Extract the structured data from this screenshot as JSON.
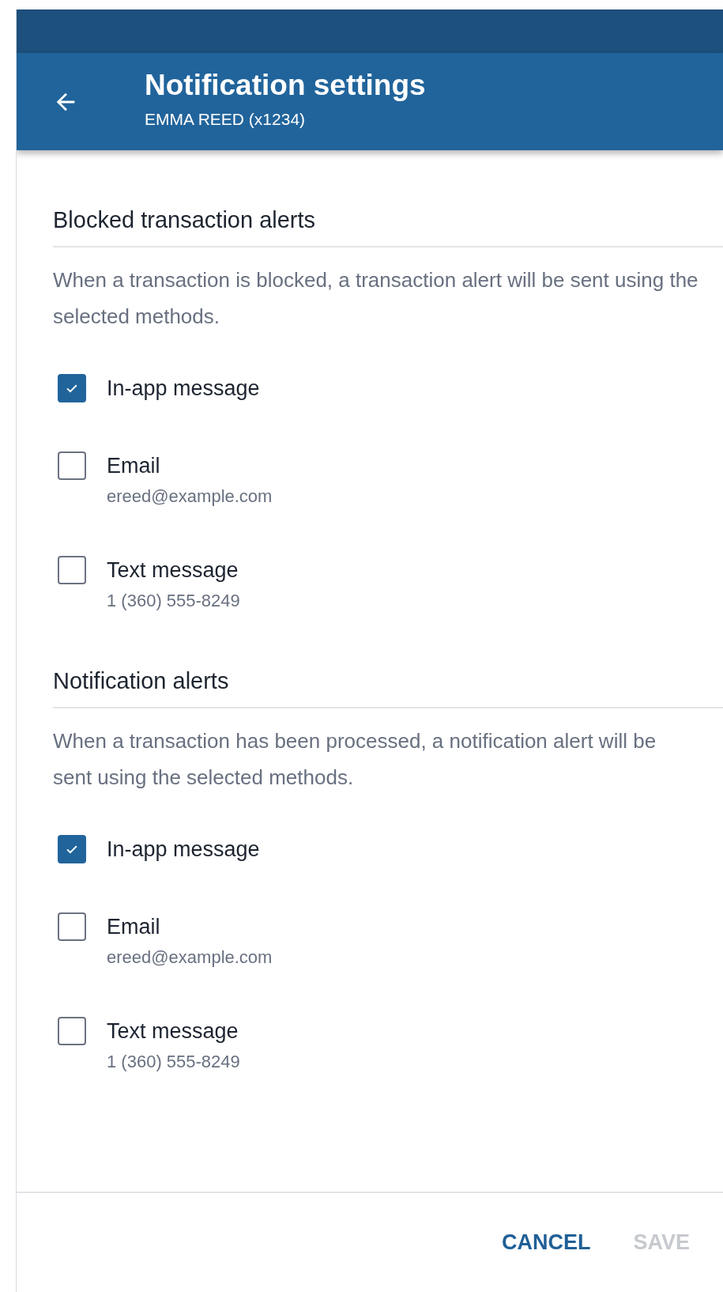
{
  "header": {
    "title": "Notification settings",
    "subtitle": "EMMA REED (x1234)"
  },
  "sections": [
    {
      "title": "Blocked transaction alerts",
      "description": "When a transaction is blocked, a transaction alert will be sent using the selected methods.",
      "options": [
        {
          "label": "In-app message",
          "checked": true
        },
        {
          "label": "Email",
          "detail": "ereed@example.com",
          "checked": false
        },
        {
          "label": "Text message",
          "detail": "1 (360) 555-8249",
          "checked": false
        }
      ]
    },
    {
      "title": "Notification alerts",
      "description": "When a transaction has been processed, a notification alert will be sent using the selected methods.",
      "options": [
        {
          "label": "In-app message",
          "checked": true
        },
        {
          "label": "Email",
          "detail": "ereed@example.com",
          "checked": false
        },
        {
          "label": "Text message",
          "detail": "1 (360) 555-8249",
          "checked": false
        }
      ]
    }
  ],
  "footer": {
    "buttons": [
      {
        "label": "CANCEL",
        "disabled": false
      },
      {
        "label": "SAVE",
        "disabled": true
      }
    ]
  }
}
